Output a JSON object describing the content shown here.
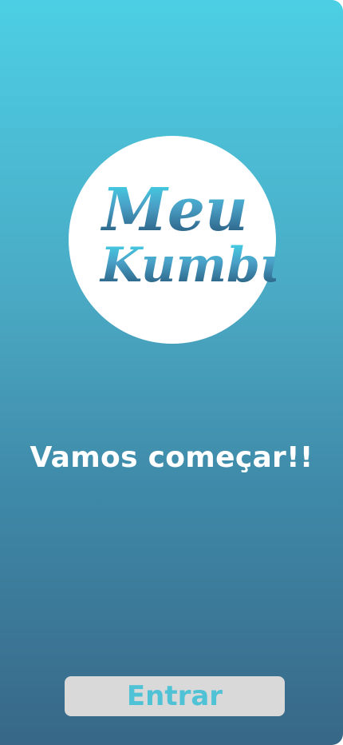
{
  "logo": {
    "line1": "Meu",
    "line2": "Kumbu",
    "gradient_top": "#41dcec",
    "gradient_bottom": "#1f4a6a"
  },
  "headline": "Vamos começar!!",
  "enter_button": {
    "label": "Entrar",
    "background": "#d9d9d9",
    "text_color": "#4fc2d6"
  },
  "colors": {
    "background_top": "#4ccfe4",
    "background_bottom": "#386787"
  }
}
